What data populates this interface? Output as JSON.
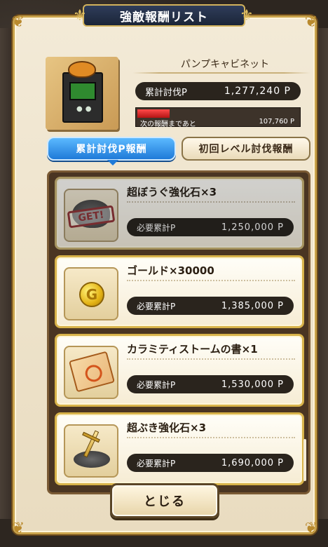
{
  "dialog": {
    "title": "強敵報酬リスト",
    "monster_name": "パンプキャビネット",
    "total_label": "累計討伐P",
    "total_value": "1,277,240 P",
    "progress_label": "次の報酬まであと",
    "progress_value": "107,760 P",
    "progress_fraction": 0.2
  },
  "tabs": [
    {
      "label": "累計討伐P報酬",
      "active": true
    },
    {
      "label": "初回レベル討伐報酬",
      "active": false
    }
  ],
  "rewards": [
    {
      "title": "超ぼうぐ強化石×3",
      "req_label": "必要累計P",
      "req_value": "1,250,000 P",
      "icon": "armor-stone-icon",
      "obtained": true,
      "stamp": "GET!"
    },
    {
      "title": "ゴールド×30000",
      "req_label": "必要累計P",
      "req_value": "1,385,000 P",
      "icon": "gold-coin-icon",
      "obtained": false,
      "coin_letter": "G"
    },
    {
      "title": "カラミティストームの書×1",
      "req_label": "必要累計P",
      "req_value": "1,530,000 P",
      "icon": "scroll-icon",
      "obtained": false
    },
    {
      "title": "超ぶき強化石×3",
      "req_label": "必要累計P",
      "req_value": "1,690,000 P",
      "icon": "weapon-stone-icon",
      "obtained": false
    }
  ],
  "close_button": {
    "label": "とじる"
  },
  "colors": {
    "tab_active": "#1f7ad8",
    "frame_gold": "#c8a24a",
    "progress_red": "#e02424"
  }
}
